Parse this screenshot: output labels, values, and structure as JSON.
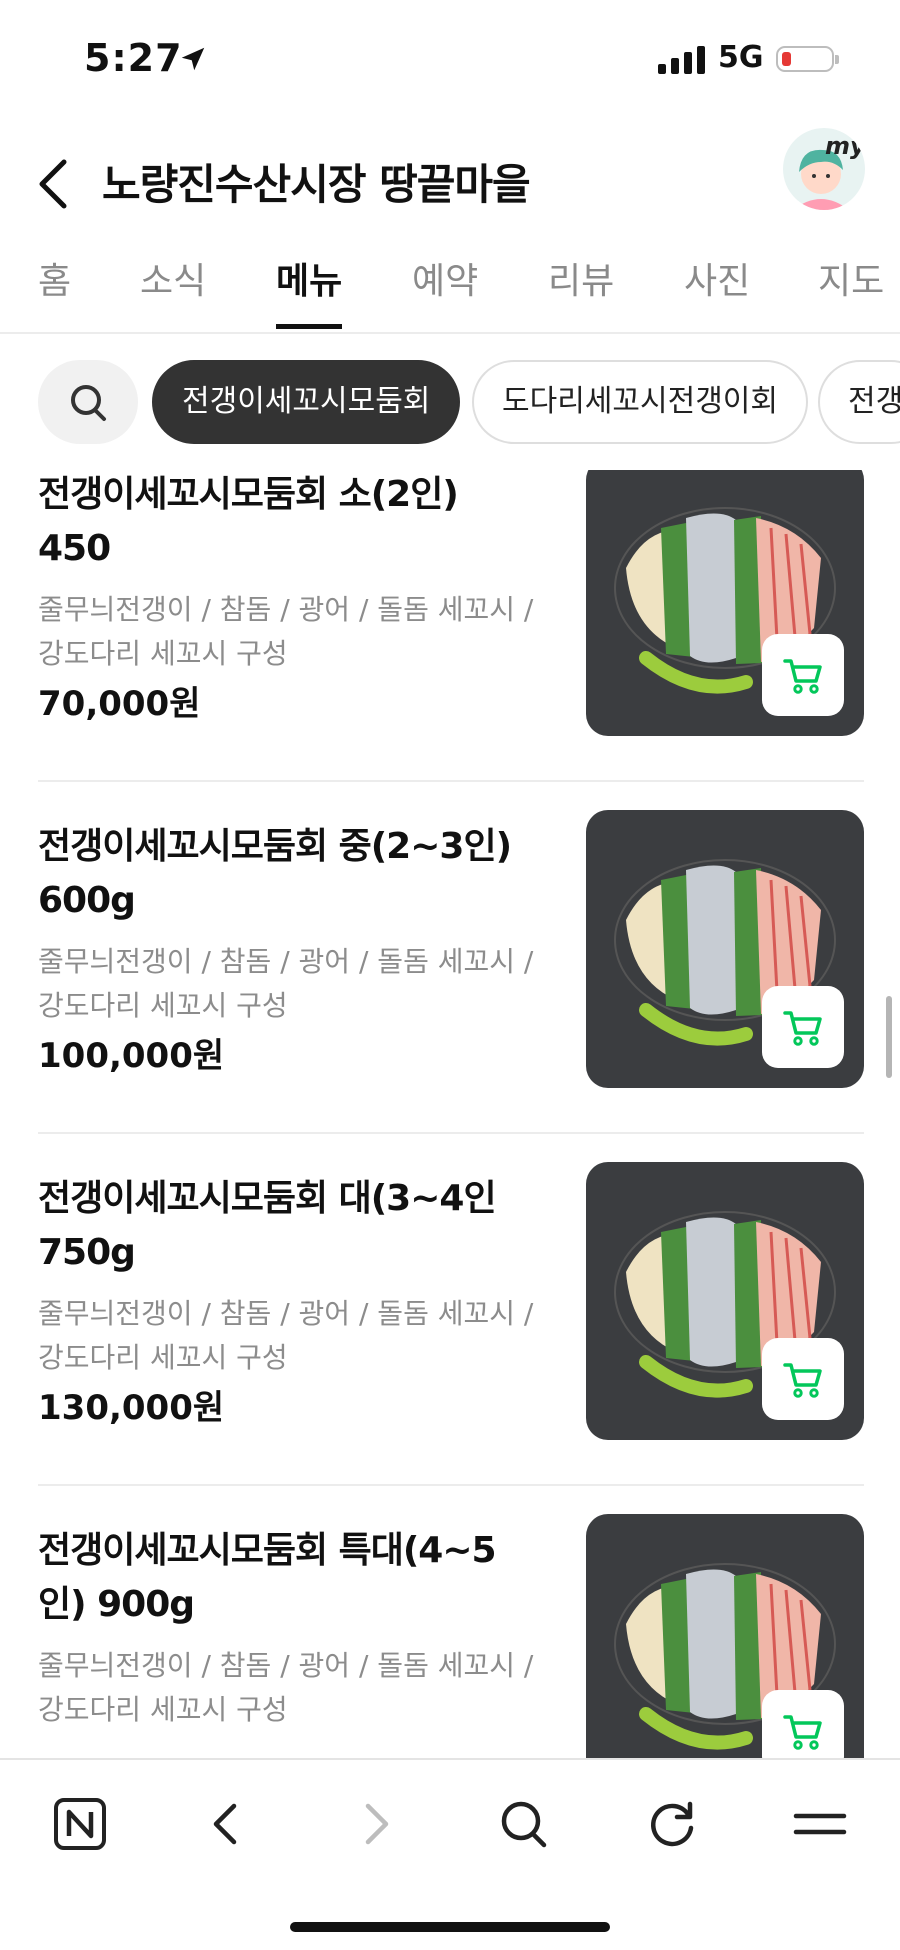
{
  "status_bar": {
    "time": "5:27",
    "network": "5G",
    "battery_percent": 10
  },
  "header": {
    "title": "노량진수산시장 땅끝마을",
    "avatar_text": "my"
  },
  "tabs": [
    {
      "label": "홈"
    },
    {
      "label": "소식"
    },
    {
      "label": "메뉴",
      "active": true
    },
    {
      "label": "예약"
    },
    {
      "label": "리뷰"
    },
    {
      "label": "사진"
    },
    {
      "label": "지도"
    }
  ],
  "chips": [
    {
      "label": "전갱이세꼬시모둠회",
      "active": true
    },
    {
      "label": "도다리세꼬시전갱이회"
    },
    {
      "label": "전갱"
    }
  ],
  "menu_items": [
    {
      "name_line1": "전갱이세꼬시모둠회 소(2인)",
      "name_line2": "450",
      "desc_line1": "줄무늬전갱이 / 참돔 / 광어 / 돌돔 세꼬시 /",
      "desc_line2": "강도다리 세꼬시 구성",
      "price": "70,000원"
    },
    {
      "name_line1": "전갱이세꼬시모둠회 중(2~3인)",
      "name_line2": "600g",
      "desc_line1": "줄무늬전갱이 / 참돔 / 광어 / 돌돔 세꼬시 /",
      "desc_line2": "강도다리 세꼬시 구성",
      "price": "100,000원"
    },
    {
      "name_line1": "전갱이세꼬시모둠회 대(3~4인",
      "name_line2": "750g",
      "desc_line1": "줄무늬전갱이 / 참돔 / 광어 / 돌돔 세꼬시 /",
      "desc_line2": "강도다리 세꼬시 구성",
      "price": "130,000원"
    },
    {
      "name_line1": "전갱이세꼬시모둠회 특대(4~5",
      "name_line2": "인) 900g",
      "desc_line1": "줄무늬전갱이 / 참돔 / 광어 / 돌돔 세꼬시 /",
      "desc_line2": "강도다리 세꼬시 구성",
      "price": ""
    }
  ],
  "colors": {
    "accent_green": "#03c75a",
    "chip_active_bg": "#333333",
    "thumb_bg": "#3b3d40"
  }
}
